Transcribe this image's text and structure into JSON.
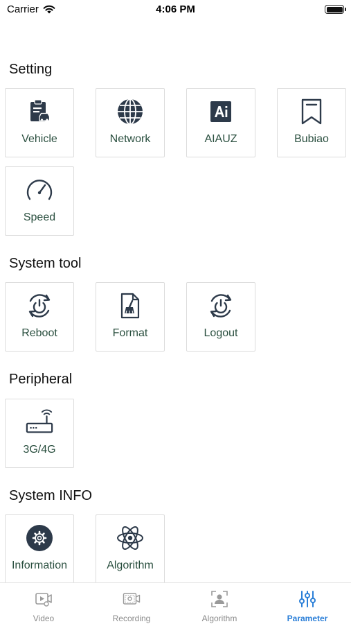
{
  "status_bar": {
    "carrier": "Carrier",
    "time": "4:06 PM"
  },
  "sections": {
    "setting": {
      "title": "Setting",
      "items": {
        "vehicle": "Vehicle",
        "network": "Network",
        "aiauz": "AIAUZ",
        "bubiao": "Bubiao",
        "speed": "Speed"
      }
    },
    "system_tool": {
      "title": "System tool",
      "items": {
        "reboot": "Reboot",
        "format": "Format",
        "logout": "Logout"
      }
    },
    "peripheral": {
      "title": "Peripheral",
      "items": {
        "modem": "3G/4G"
      }
    },
    "system_info": {
      "title": "System INFO",
      "items": {
        "information": "Information",
        "algorithm": "Algorithm"
      }
    }
  },
  "tab_bar": {
    "active": "parameter",
    "tabs": {
      "video": "Video",
      "recording": "Recording",
      "algorithm": "Algorithm",
      "parameter": "Parameter"
    }
  },
  "colors": {
    "icon": "#2d3a4a",
    "label": "#2a4f3f",
    "active_tab": "#2b7fd8",
    "inactive_tab": "#8a8a8a"
  },
  "icons": {
    "vehicle": "clipboard-car-icon",
    "network": "globe-icon",
    "aiauz": "ai-badge-icon",
    "bubiao": "bookmark-icon",
    "speed": "speedometer-icon",
    "reboot": "power-cycle-icon",
    "format": "document-broom-icon",
    "logout": "power-cycle-icon",
    "modem": "router-icon",
    "information": "gear-circle-icon",
    "algorithm": "atom-icon"
  }
}
